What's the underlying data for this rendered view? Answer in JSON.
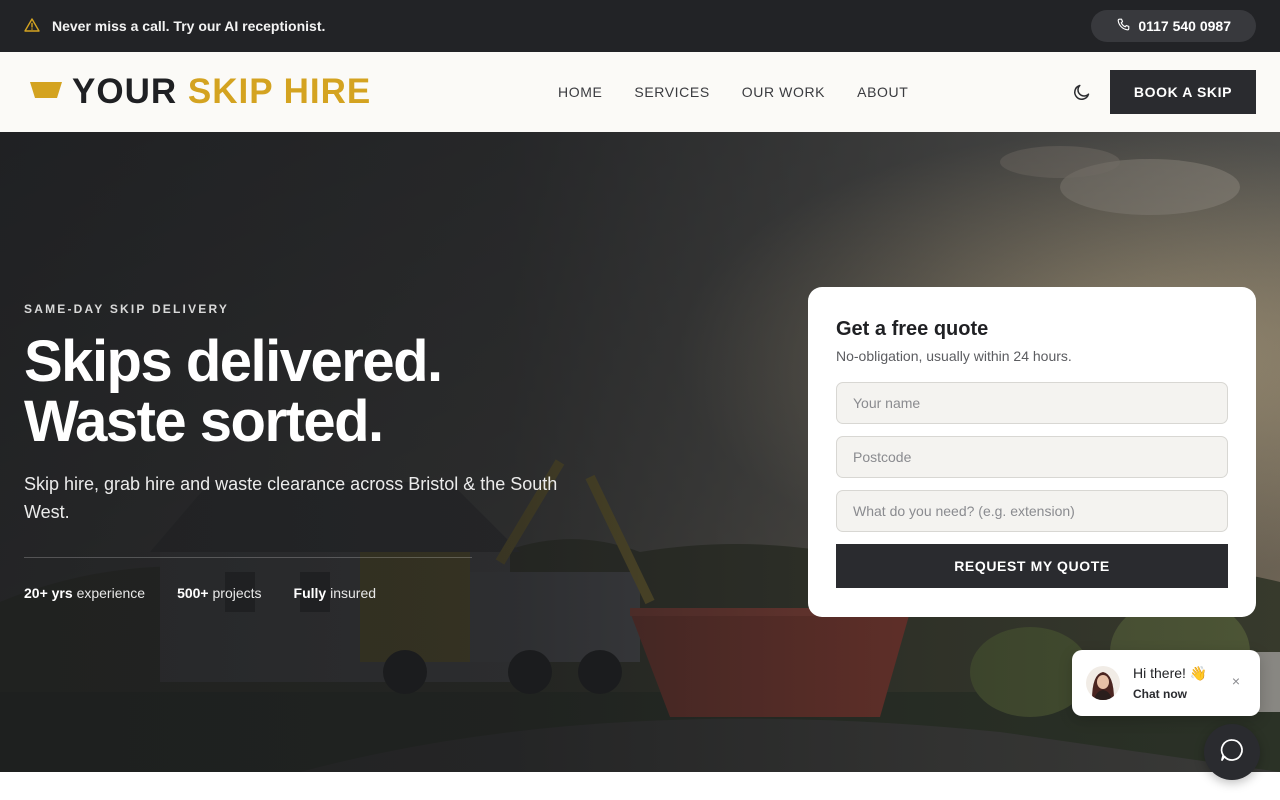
{
  "topbar": {
    "icon": "warning-triangle-icon",
    "announcement": "Never miss a call. Try our AI receptionist.",
    "phone_icon": "phone-icon",
    "phone": "0117 540 0987"
  },
  "header": {
    "logo_icon": "skip-bin-logo-icon",
    "logo_word1": "YOUR",
    "logo_word2": "SKIP HIRE",
    "nav": [
      {
        "label": "HOME"
      },
      {
        "label": "SERVICES"
      },
      {
        "label": "OUR WORK"
      },
      {
        "label": "ABOUT"
      }
    ],
    "theme_icon": "moon-icon",
    "cta": "BOOK A SKIP"
  },
  "hero": {
    "eyebrow": "SAME-DAY SKIP DELIVERY",
    "headline_line1": "Skips delivered.",
    "headline_line2": "Waste sorted.",
    "subhead": "Skip hire, grab hire and waste clearance across Bristol & the South West.",
    "stats": [
      {
        "value": "20+ yrs",
        "label": "experience"
      },
      {
        "value": "500+",
        "label": "projects"
      },
      {
        "value": "Fully",
        "label": "insured"
      }
    ]
  },
  "quote_form": {
    "title": "Get a free quote",
    "subtitle": "No-obligation, usually within 24 hours.",
    "name_placeholder": "Your name",
    "postcode_placeholder": "Postcode",
    "need_placeholder": "What do you need? (e.g. extension)",
    "submit": "REQUEST MY QUOTE"
  },
  "chat": {
    "greeting": "Hi there! 👋",
    "action": "Chat now",
    "close_icon": "close-icon",
    "launcher_icon": "chat-bubble-icon"
  },
  "colors": {
    "brand_yellow": "#d4a320",
    "dark": "#2a2b2f",
    "topbar_bg": "#222326",
    "header_bg": "#fbfaf7"
  }
}
